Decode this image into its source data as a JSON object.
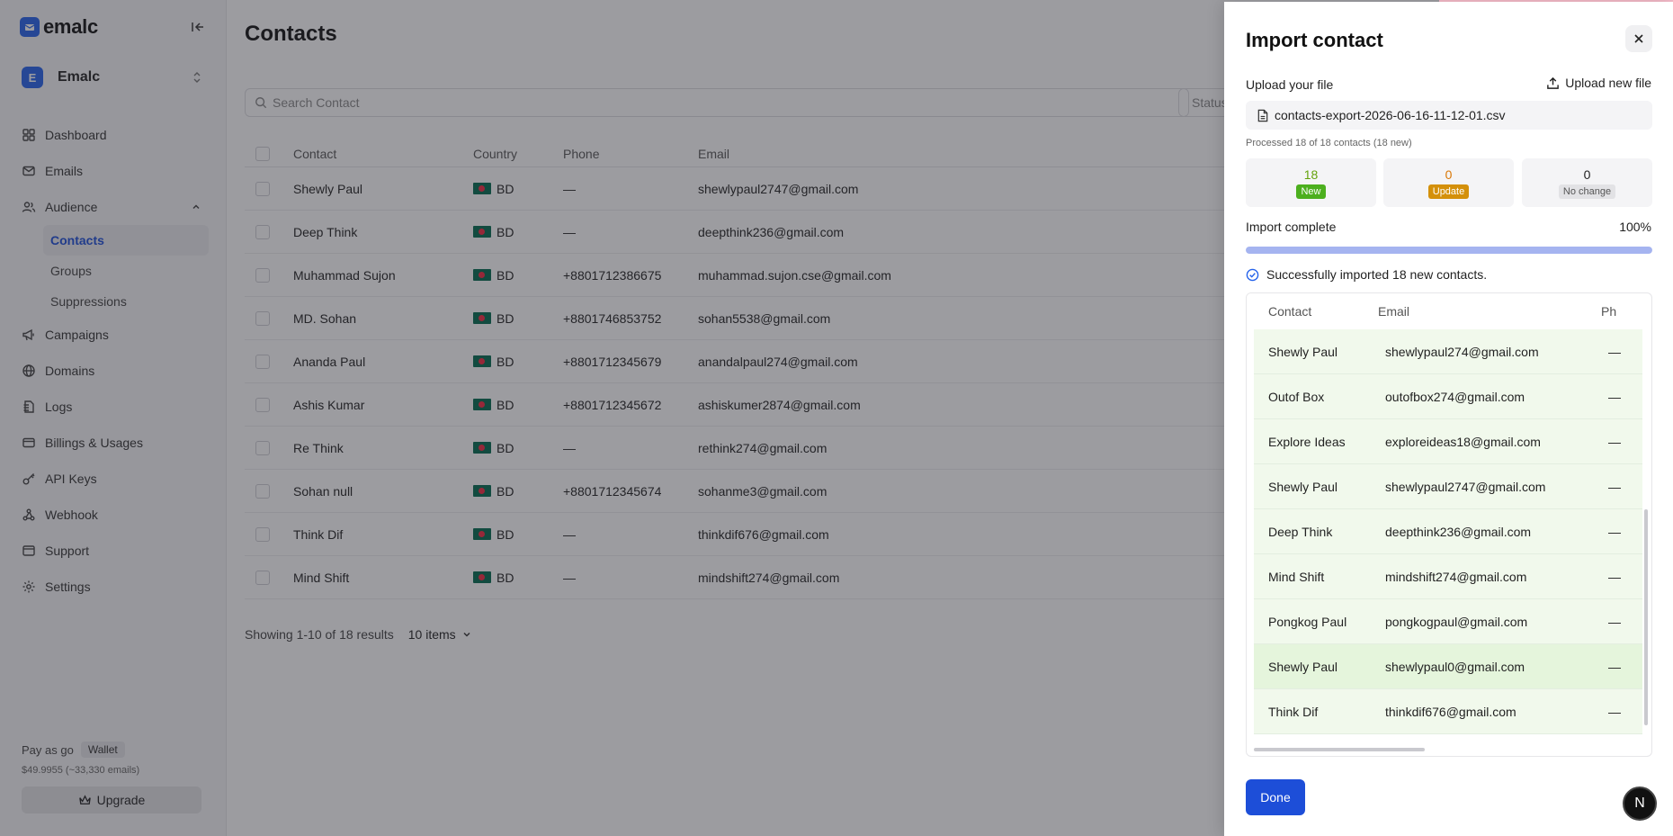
{
  "app": {
    "logo_text": "emalc",
    "brand_color": "#2563eb"
  },
  "workspace": {
    "initial": "E",
    "name": "Emalc"
  },
  "sidebar": {
    "items": [
      {
        "label": "Dashboard",
        "icon": "dashboard-icon"
      },
      {
        "label": "Emails",
        "icon": "mail-icon"
      },
      {
        "label": "Audience",
        "icon": "users-icon",
        "expanded": true
      },
      {
        "label": "Campaigns",
        "icon": "megaphone-icon"
      },
      {
        "label": "Domains",
        "icon": "globe-icon"
      },
      {
        "label": "Logs",
        "icon": "logs-icon"
      },
      {
        "label": "Billings & Usages",
        "icon": "billing-icon"
      },
      {
        "label": "API Keys",
        "icon": "key-icon"
      },
      {
        "label": "Webhook",
        "icon": "webhook-icon"
      },
      {
        "label": "Support",
        "icon": "support-icon"
      },
      {
        "label": "Settings",
        "icon": "settings-icon"
      }
    ],
    "audience_sub": [
      "Contacts",
      "Groups",
      "Suppressions"
    ],
    "plan_label": "Pay as go",
    "wallet_badge": "Wallet",
    "balance": "$49.9955 (~33,330 emails)",
    "upgrade_label": "Upgrade"
  },
  "main": {
    "title": "Contacts",
    "search_placeholder": "Search Contact",
    "status_filter": "Status",
    "columns": [
      "Contact",
      "Country",
      "Phone",
      "Email"
    ],
    "rows": [
      {
        "name": "Shewly Paul",
        "country": "BD",
        "phone": "—",
        "email": "shewlypaul2747@gmail.com"
      },
      {
        "name": "Deep Think",
        "country": "BD",
        "phone": "—",
        "email": "deepthink236@gmail.com"
      },
      {
        "name": "Muhammad Sujon",
        "country": "BD",
        "phone": "+8801712386675",
        "email": "muhammad.sujon.cse@gmail.com"
      },
      {
        "name": "MD. Sohan",
        "country": "BD",
        "phone": "+8801746853752",
        "email": "sohan5538@gmail.com"
      },
      {
        "name": "Ananda Paul",
        "country": "BD",
        "phone": "+8801712345679",
        "email": "anandalpaul274@gmail.com"
      },
      {
        "name": "Ashis Kumar",
        "country": "BD",
        "phone": "+8801712345672",
        "email": "ashiskumer2874@gmail.com"
      },
      {
        "name": "Re Think",
        "country": "BD",
        "phone": "—",
        "email": "rethink274@gmail.com"
      },
      {
        "name": "Sohan null",
        "country": "BD",
        "phone": "+8801712345674",
        "email": "sohanme3@gmail.com"
      },
      {
        "name": "Think Dif",
        "country": "BD",
        "phone": "—",
        "email": "thinkdif676@gmail.com"
      },
      {
        "name": "Mind Shift",
        "country": "BD",
        "phone": "—",
        "email": "mindshift274@gmail.com"
      }
    ],
    "showing": "Showing 1-10 of 18 results",
    "items_per_page": "10 items"
  },
  "import_panel": {
    "title": "Import contact",
    "upload_label": "Upload your file",
    "upload_new_label": "Upload new file",
    "file_name": "contacts-export-2026-06-16-11-12-01.csv",
    "processed_text": "Processed 18 of 18 contacts (18 new)",
    "stats": [
      {
        "value": "18",
        "label": "New",
        "num_color": "#65a30d",
        "tag_bg": "#4caf1e",
        "tag_color": "#ffffff"
      },
      {
        "value": "0",
        "label": "Update",
        "num_color": "#d97706",
        "tag_bg": "#d4900a",
        "tag_color": "#ffffff"
      },
      {
        "value": "0",
        "label": "No change",
        "num_color": "#222222",
        "tag_bg": "#e2e2e5",
        "tag_color": "#555555"
      }
    ],
    "progress_label": "Import complete",
    "progress_pct": "100%",
    "progress_value": 1.0,
    "success_text": "Successfully imported 18 new contacts.",
    "result_columns": [
      "Contact",
      "Email",
      "Ph"
    ],
    "result_rows": [
      {
        "name": "Shewly Paul",
        "email": "shewlypaul274@gmail.com",
        "phone": "—"
      },
      {
        "name": "Outof Box",
        "email": "outofbox274@gmail.com",
        "phone": "—"
      },
      {
        "name": "Explore Ideas",
        "email": "exploreideas18@gmail.com",
        "phone": "—"
      },
      {
        "name": "Shewly Paul",
        "email": "shewlypaul2747@gmail.com",
        "phone": "—"
      },
      {
        "name": "Deep Think",
        "email": "deepthink236@gmail.com",
        "phone": "—"
      },
      {
        "name": "Mind Shift",
        "email": "mindshift274@gmail.com",
        "phone": "—"
      },
      {
        "name": "Pongkog Paul",
        "email": "pongkogpaul@gmail.com",
        "phone": "—"
      },
      {
        "name": "Shewly Paul",
        "email": "shewlypaul0@gmail.com",
        "phone": "—",
        "highlighted": true
      },
      {
        "name": "Think Dif",
        "email": "thinkdif676@gmail.com",
        "phone": "—"
      }
    ],
    "done_label": "Done"
  },
  "assistant_badge": "N"
}
